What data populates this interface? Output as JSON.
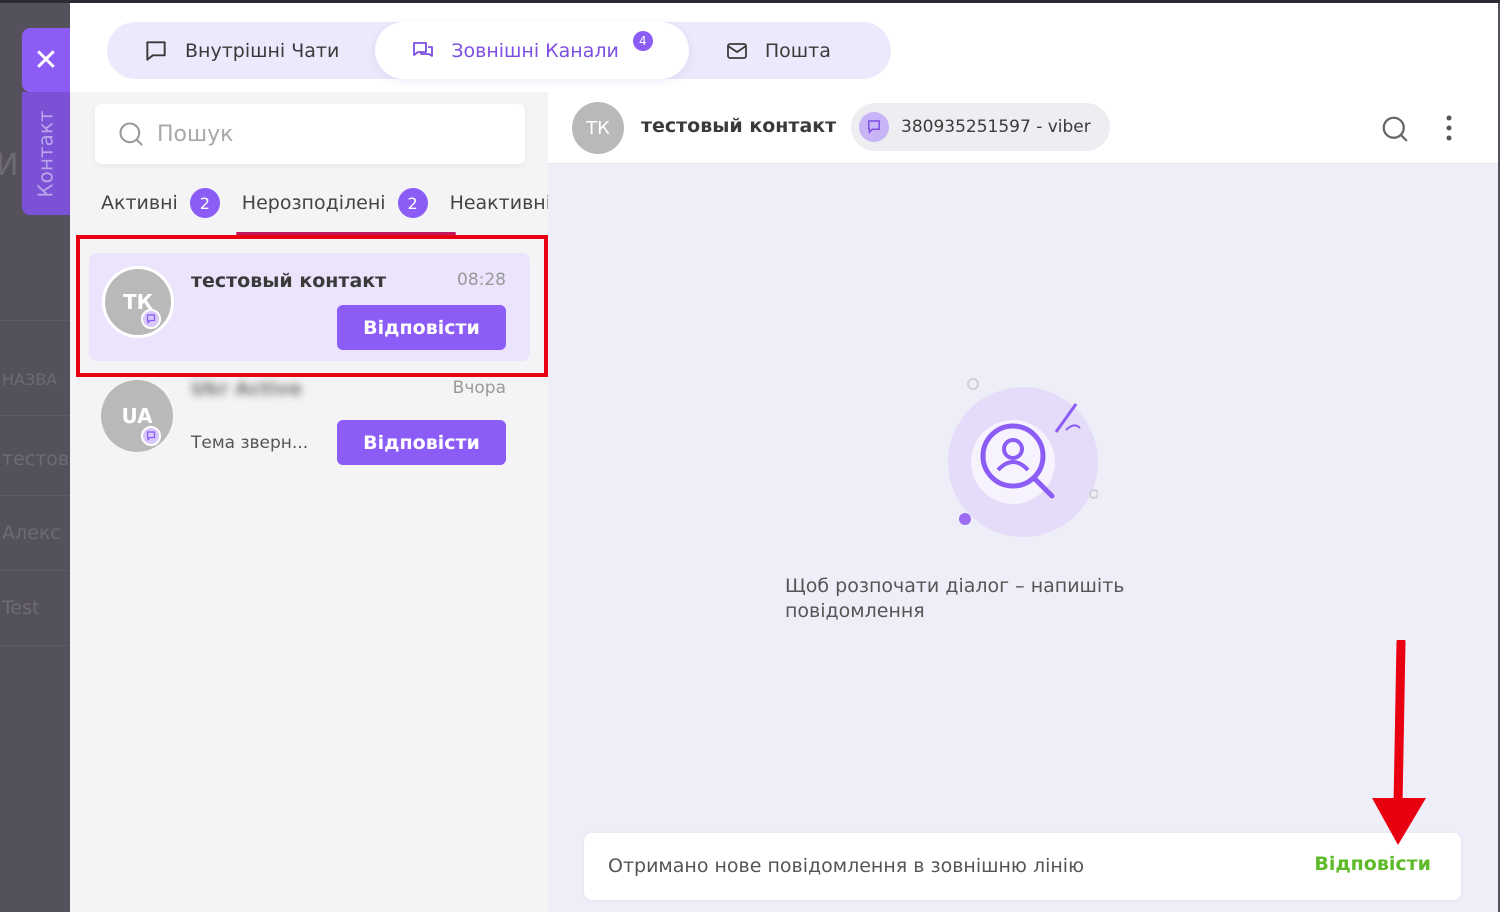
{
  "background": {
    "side_tab_label": "Контакт",
    "partial_texts": [
      "НАЗВА",
      "тестов",
      "Алекс",
      "Test"
    ],
    "partial_letter": "И"
  },
  "tabs": [
    {
      "label": "Внутрішні Чати",
      "icon": "chat-bubble-icon",
      "active": false
    },
    {
      "label": "Зовнішні Канали",
      "icon": "chat-channels-icon",
      "active": true,
      "badge": "4"
    },
    {
      "label": "Пошта",
      "icon": "mail-icon",
      "active": false
    }
  ],
  "search": {
    "placeholder": "Пошук"
  },
  "filters": [
    {
      "label": "Активні",
      "count": "2"
    },
    {
      "label": "Нерозподілені",
      "count": "2"
    },
    {
      "label": "Неактивні"
    }
  ],
  "conversations": [
    {
      "initials": "ТК",
      "name": "тестовый контакт",
      "time": "08:28",
      "subtitle": "",
      "button": "Відповісти"
    },
    {
      "initials": "UA",
      "name": "Ukr Active",
      "time": "Вчора",
      "subtitle": "Тема зверн...",
      "button": "Відповісти"
    }
  ],
  "chat": {
    "avatar_initials": "ТК",
    "contact_name": "тестовый контакт",
    "channel": "380935251597 - viber",
    "empty_text": "Щоб розпочати діалог – напишіть повідомлення"
  },
  "notice": {
    "text": "Отримано нове повідомлення в зовнішню лінію",
    "button": "Відповісти"
  },
  "colors": {
    "accent": "#8b5cf6",
    "highlight": "#e80010",
    "reply_link": "#5dbb2a"
  }
}
